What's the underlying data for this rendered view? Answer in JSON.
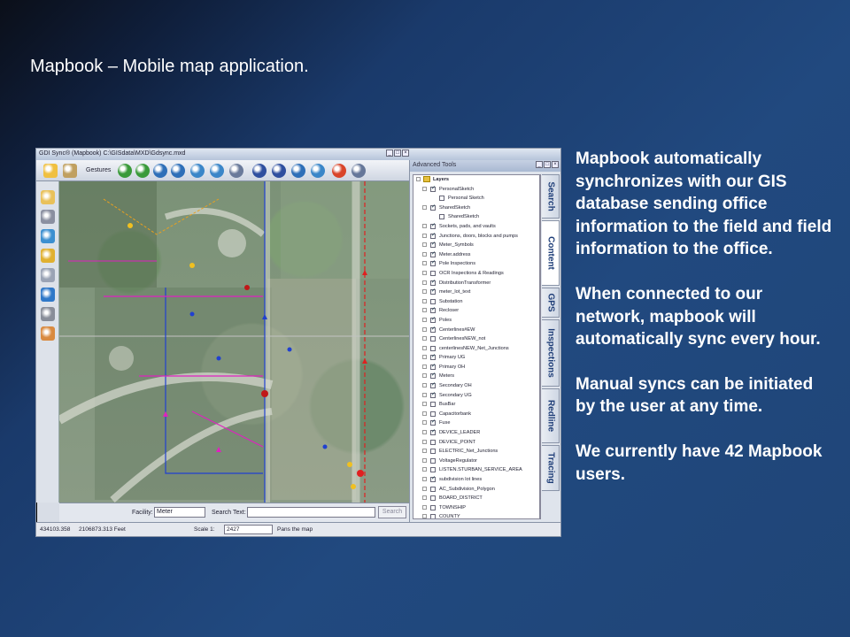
{
  "slide": {
    "title": "Mapbook – Mobile map application.",
    "paragraphs": [
      "Mapbook  automatically synchronizes  with our GIS database sending office information to the field and field information to the office.",
      "When connected to our network, mapbook will automatically sync every hour.",
      "Manual syncs can be initiated by the user at any time.",
      "We currently have 42 Mapbook users."
    ]
  },
  "app": {
    "title": "GDI Sync® (Mapbook)    C:\\GISdata\\MXD\\Gdsync.mxd",
    "toolbar": {
      "gestures_label": "Gestures",
      "icons": [
        "pan-hand-icon",
        "pencil-icon",
        "back-icon",
        "forward-icon",
        "find-icon",
        "zoom-in-icon",
        "full-extent-icon",
        "info-icon",
        "measure-icon",
        "help-icon",
        "help2-icon",
        "search-icon",
        "globe-icon",
        "gps-icon",
        "more-icon"
      ],
      "colors": [
        "#f0c040",
        "#c0a060",
        "#3a9a3a",
        "#3a9a3a",
        "#2e6fb8",
        "#2e6fb8",
        "#3a86c8",
        "#3a86c8",
        "#6a7a9a",
        "#2f4f9f",
        "#2f4f9f",
        "#2e6fb8",
        "#3a86c8",
        "#d9452a",
        "#667799"
      ]
    },
    "left_tools": {
      "icons": [
        "folder-icon",
        "print-icon",
        "sync-icon",
        "layers-icon",
        "edit-icon",
        "globe-icon",
        "gear-icon",
        "palette-icon"
      ],
      "colors": [
        "#e9c15a",
        "#8a8fa0",
        "#3c8fd0",
        "#e0b030",
        "#9aa3b5",
        "#2f78c8",
        "#888d99",
        "#d98a40"
      ]
    },
    "search": {
      "facility_label": "Facility:",
      "facility_value": "Meter",
      "text_label": "Search Text:",
      "text_value": "",
      "search_button": "Search"
    },
    "status": {
      "coord1": "434103.358",
      "coord2": "2106873.313 Feet",
      "scale_label": "Scale 1:",
      "scale_value": "2427",
      "message": "Pans the map"
    },
    "advanced_tools": {
      "title": "Advanced Tools",
      "root": "Layers",
      "layers": [
        {
          "name": "PersonalSketch",
          "checked": true,
          "indent": 1
        },
        {
          "name": "Personal Sketch",
          "checked": false,
          "indent": 2
        },
        {
          "name": "SharedSketch",
          "checked": true,
          "indent": 1
        },
        {
          "name": "SharedSketch",
          "checked": false,
          "indent": 2
        },
        {
          "name": "Sockets, pads, and vaults",
          "checked": true,
          "indent": 1
        },
        {
          "name": "Junctions, doors, blocks and pumps",
          "checked": true,
          "indent": 1
        },
        {
          "name": "Meter_Symbols",
          "checked": true,
          "indent": 1
        },
        {
          "name": "Meter.address",
          "checked": true,
          "indent": 1
        },
        {
          "name": "Pole Inspections",
          "checked": true,
          "indent": 1
        },
        {
          "name": "OCR Inspections & Readings",
          "checked": false,
          "indent": 1
        },
        {
          "name": "DistributionTransformer",
          "checked": true,
          "indent": 1
        },
        {
          "name": "meter_lot_text",
          "checked": true,
          "indent": 1
        },
        {
          "name": "Substation",
          "checked": false,
          "indent": 1
        },
        {
          "name": "Recloser",
          "checked": true,
          "indent": 1
        },
        {
          "name": "Poles",
          "checked": true,
          "indent": 1
        },
        {
          "name": "Centerlines#EW",
          "checked": true,
          "indent": 1
        },
        {
          "name": "CenterlinesNEW_not",
          "checked": false,
          "indent": 1
        },
        {
          "name": "centerlinesNEW_Net_Junctions",
          "checked": false,
          "indent": 1
        },
        {
          "name": "Primary UG",
          "checked": true,
          "indent": 1
        },
        {
          "name": "Primary OH",
          "checked": true,
          "indent": 1
        },
        {
          "name": "Meters",
          "checked": true,
          "indent": 1
        },
        {
          "name": "Secondary OH",
          "checked": true,
          "indent": 1
        },
        {
          "name": "Secondary UG",
          "checked": true,
          "indent": 1
        },
        {
          "name": "BusBar",
          "checked": false,
          "indent": 1
        },
        {
          "name": "Capacitorbank",
          "checked": false,
          "indent": 1
        },
        {
          "name": "Fuse",
          "checked": true,
          "indent": 1
        },
        {
          "name": "DEVICE_LEADER",
          "checked": true,
          "indent": 1
        },
        {
          "name": "DEVICE_POINT",
          "checked": false,
          "indent": 1
        },
        {
          "name": "ELECTRIC_Net_Junctions",
          "checked": false,
          "indent": 1
        },
        {
          "name": "VoltageRegulator",
          "checked": false,
          "indent": 1
        },
        {
          "name": "LISTEN.STURBAN_SERVICE_AREA",
          "checked": false,
          "indent": 1
        },
        {
          "name": "subdivision lot lines",
          "checked": true,
          "indent": 1
        },
        {
          "name": "AC_Subdivision_Polygon",
          "checked": false,
          "indent": 1
        },
        {
          "name": "BOARD_DISTRICT",
          "checked": false,
          "indent": 1
        },
        {
          "name": "TOWNSHIP",
          "checked": false,
          "indent": 1
        },
        {
          "name": "COUNTY",
          "checked": false,
          "indent": 1
        },
        {
          "name": "AVE_ROUTES",
          "checked": false,
          "indent": 1
        },
        {
          "name": "MAP_GRID",
          "checked": false,
          "indent": 1
        },
        {
          "name": "allen_co_sid",
          "checked": true,
          "indent": 1
        },
        {
          "name": "whitley_co_sid",
          "checked": true,
          "indent": 1
        }
      ],
      "tabs": [
        "Search",
        "Content",
        "GPS",
        "Inspections",
        "Redline",
        "Tracing"
      ]
    }
  }
}
